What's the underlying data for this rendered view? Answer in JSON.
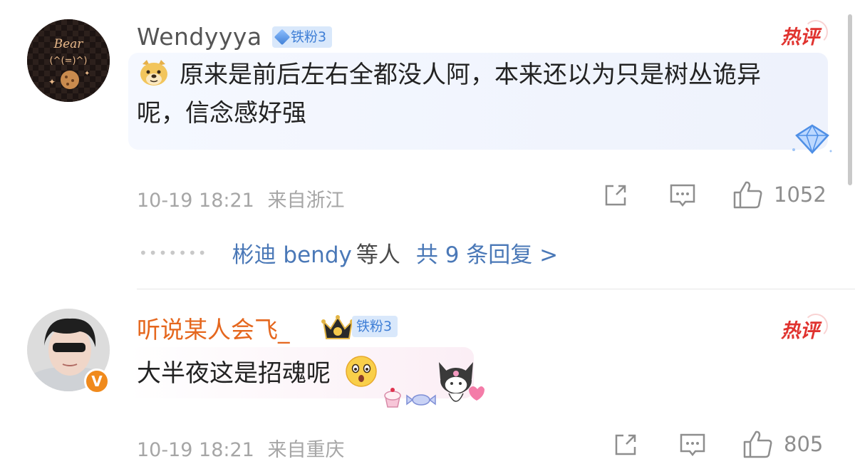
{
  "comments": [
    {
      "username": "Wendyyya",
      "fan_badge": "铁粉3",
      "hot_label": "热评",
      "avatar_text": "Bear",
      "text": "原来是前后左右全都没人阿，本来还以为只是树丛诡异呢，信念感好强",
      "time": "10-19 18:21",
      "location": "来自浙江",
      "likes": "1052",
      "replies": {
        "names": "彬迪 bendy",
        "suffix": "等人",
        "total": "共 9 条回复 >"
      }
    },
    {
      "username": "听说某人会飞_",
      "fan_badge": "铁粉3",
      "hot_label": "热评",
      "verified_mark": "V",
      "text": "大半夜这是招魂呢",
      "time": "10-19 18:21",
      "location": "来自重庆",
      "likes": "805"
    }
  ],
  "colors": {
    "username_normal": "#555555",
    "username_vip": "#e5671e",
    "link_blue": "#4a78b7",
    "hot_red": "#e0332f",
    "meta_gray": "#a6a6a6"
  },
  "icons": [
    "doge-emoji-icon",
    "crown-icon",
    "share-icon",
    "comment-icon",
    "like-icon",
    "surprised-emoji-icon",
    "kuromi-sticker-icon",
    "diamond-icon"
  ]
}
